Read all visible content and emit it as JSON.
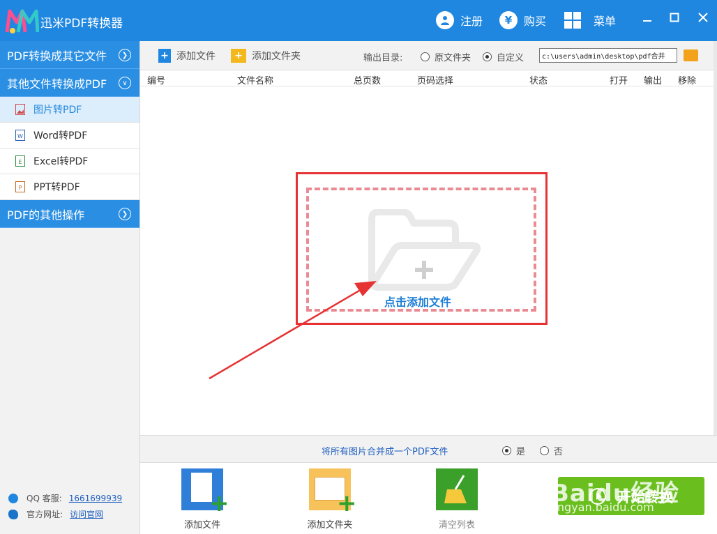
{
  "app": {
    "title": "迅米PDF转换器"
  },
  "titlebar": {
    "register": "注册",
    "buy": "购买",
    "menu": "菜单",
    "buy_symbol": "¥"
  },
  "sidebar": {
    "cat1": "PDF转换成其它文件",
    "cat2": "其他文件转换成PDF",
    "items": [
      {
        "label": "图片转PDF",
        "icon": "image-file-icon",
        "active": true
      },
      {
        "label": "Word转PDF",
        "icon": "word-file-icon",
        "glyph": "W"
      },
      {
        "label": "Excel转PDF",
        "icon": "excel-file-icon",
        "glyph": "E"
      },
      {
        "label": "PPT转PDF",
        "icon": "ppt-file-icon",
        "glyph": "P"
      }
    ],
    "cat3": "PDF的其他操作",
    "qq_label": "QQ 客服:",
    "qq_value": "1661699939",
    "site_label": "官方网址:",
    "site_link": "访问官网"
  },
  "toolbar": {
    "add_file": "添加文件",
    "add_folder": "添加文件夹",
    "output_label": "输出目录:",
    "opt_source": "原文件夹",
    "opt_custom": "自定义",
    "selected": "custom",
    "path": "c:\\users\\admin\\desktop\\pdf合并"
  },
  "table": {
    "columns": [
      "编号",
      "文件名称",
      "总页数",
      "页码选择",
      "状态",
      "打开",
      "输出",
      "移除"
    ]
  },
  "dropzone": {
    "text": "点击添加文件"
  },
  "merge": {
    "label": "将所有图片合并成一个PDF文件",
    "yes": "是",
    "no": "否",
    "selected": "yes"
  },
  "bottom": {
    "add_file": "添加文件",
    "add_folder": "添加文件夹",
    "clear": "清空列表",
    "start": "开始转换"
  },
  "watermark": {
    "brand": "Baidu经验",
    "url": "jingyan.baidu.com"
  },
  "colors": {
    "accent": "#1f87e0",
    "start": "#6abf1f",
    "highlight": "#e63232"
  }
}
